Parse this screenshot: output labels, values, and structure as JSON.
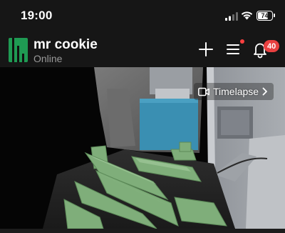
{
  "status_bar": {
    "time": "19:00",
    "battery_level": "74",
    "battery_fraction": 0.74,
    "icons": [
      "cellular-signal-icon",
      "wifi-icon",
      "battery-icon"
    ]
  },
  "header": {
    "device_name": "mr cookie",
    "device_status": "Online",
    "notification_count": "40",
    "icons": [
      "logo-icon",
      "plus-icon",
      "menu-icon",
      "bell-icon"
    ]
  },
  "camera": {
    "timelapse_label": "Timelapse",
    "icons": [
      "video-camera-icon",
      "chevron-right-icon"
    ]
  },
  "colors": {
    "brand_green": "#1f9a53",
    "badge_red": "#e84040",
    "background": "#161616",
    "muted_text": "#9a9a9a"
  }
}
